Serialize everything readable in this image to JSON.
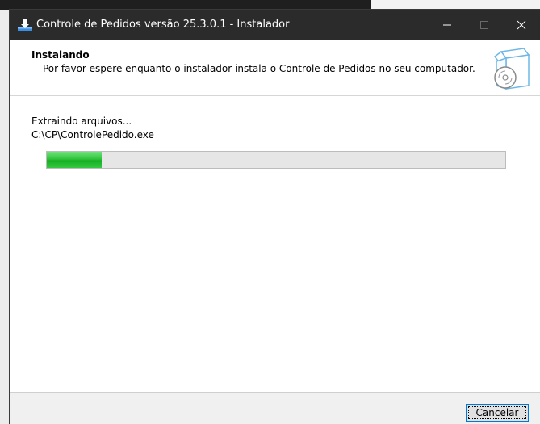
{
  "window": {
    "title": "Controle de Pedidos versão 25.3.0.1 - Instalador"
  },
  "header": {
    "title": "Instalando",
    "description": "Por favor espere enquanto o instalador instala o Controle de Pedidos no seu computador."
  },
  "status": {
    "label": "Extraindo arquivos...",
    "detail": "C:\\CP\\ControlePedido.exe"
  },
  "progress": {
    "fraction": 0.12
  },
  "footer": {
    "cancel_label": "Cancelar"
  },
  "icons": {
    "app": "installer-download-icon",
    "header": "software-box-cd-icon"
  },
  "colors": {
    "titlebar": "#2b2b2b",
    "progress": "#17b125",
    "focus": "#0078d7"
  }
}
